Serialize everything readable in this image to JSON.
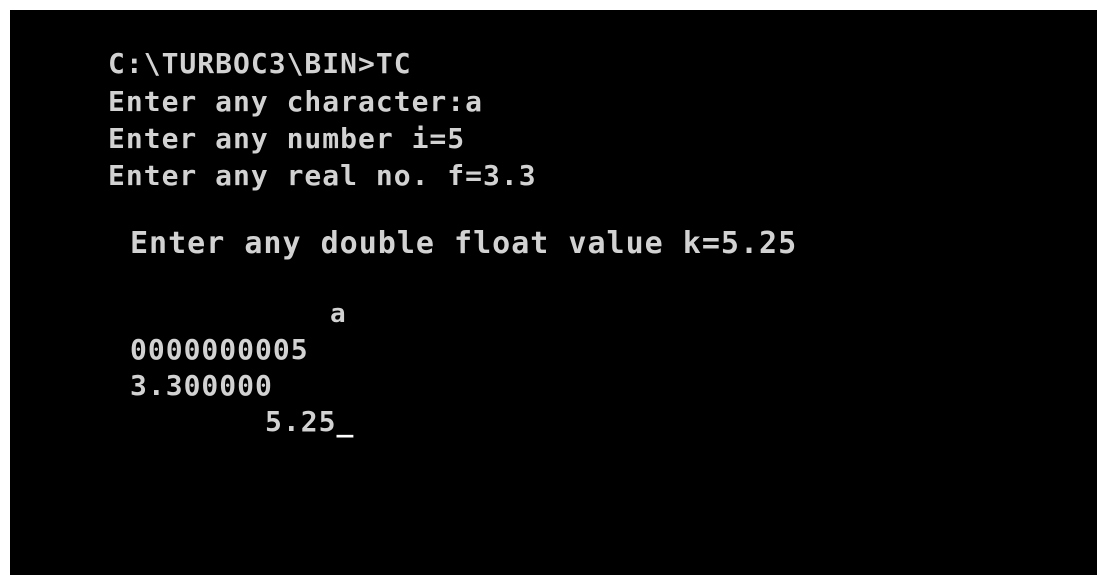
{
  "terminal": {
    "prompt_line": "C:\\TURBOC3\\BIN>TC",
    "input_char_line": "Enter any character:a",
    "input_int_line": "Enter any number i=5",
    "input_real_line": "Enter any real no. f=3.3",
    "input_double_line": "Enter any double float value k=5.25",
    "output_char": "a",
    "output_int": "0000000005",
    "output_real": "3.300000",
    "output_double": "5.25",
    "cursor": "_"
  },
  "colors": {
    "background": "#000000",
    "text": "#d2d2d2",
    "frame": "#ffffff"
  }
}
